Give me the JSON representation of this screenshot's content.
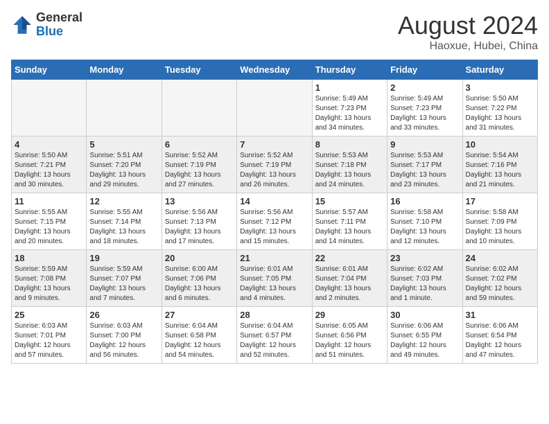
{
  "logo": {
    "text_general": "General",
    "text_blue": "Blue"
  },
  "title": "August 2024",
  "subtitle": "Haoxue, Hubei, China",
  "days_of_week": [
    "Sunday",
    "Monday",
    "Tuesday",
    "Wednesday",
    "Thursday",
    "Friday",
    "Saturday"
  ],
  "weeks": [
    [
      {
        "day": "",
        "info": ""
      },
      {
        "day": "",
        "info": ""
      },
      {
        "day": "",
        "info": ""
      },
      {
        "day": "",
        "info": ""
      },
      {
        "day": "1",
        "info": "Sunrise: 5:49 AM\nSunset: 7:23 PM\nDaylight: 13 hours\nand 34 minutes."
      },
      {
        "day": "2",
        "info": "Sunrise: 5:49 AM\nSunset: 7:23 PM\nDaylight: 13 hours\nand 33 minutes."
      },
      {
        "day": "3",
        "info": "Sunrise: 5:50 AM\nSunset: 7:22 PM\nDaylight: 13 hours\nand 31 minutes."
      }
    ],
    [
      {
        "day": "4",
        "info": "Sunrise: 5:50 AM\nSunset: 7:21 PM\nDaylight: 13 hours\nand 30 minutes."
      },
      {
        "day": "5",
        "info": "Sunrise: 5:51 AM\nSunset: 7:20 PM\nDaylight: 13 hours\nand 29 minutes."
      },
      {
        "day": "6",
        "info": "Sunrise: 5:52 AM\nSunset: 7:19 PM\nDaylight: 13 hours\nand 27 minutes."
      },
      {
        "day": "7",
        "info": "Sunrise: 5:52 AM\nSunset: 7:19 PM\nDaylight: 13 hours\nand 26 minutes."
      },
      {
        "day": "8",
        "info": "Sunrise: 5:53 AM\nSunset: 7:18 PM\nDaylight: 13 hours\nand 24 minutes."
      },
      {
        "day": "9",
        "info": "Sunrise: 5:53 AM\nSunset: 7:17 PM\nDaylight: 13 hours\nand 23 minutes."
      },
      {
        "day": "10",
        "info": "Sunrise: 5:54 AM\nSunset: 7:16 PM\nDaylight: 13 hours\nand 21 minutes."
      }
    ],
    [
      {
        "day": "11",
        "info": "Sunrise: 5:55 AM\nSunset: 7:15 PM\nDaylight: 13 hours\nand 20 minutes."
      },
      {
        "day": "12",
        "info": "Sunrise: 5:55 AM\nSunset: 7:14 PM\nDaylight: 13 hours\nand 18 minutes."
      },
      {
        "day": "13",
        "info": "Sunrise: 5:56 AM\nSunset: 7:13 PM\nDaylight: 13 hours\nand 17 minutes."
      },
      {
        "day": "14",
        "info": "Sunrise: 5:56 AM\nSunset: 7:12 PM\nDaylight: 13 hours\nand 15 minutes."
      },
      {
        "day": "15",
        "info": "Sunrise: 5:57 AM\nSunset: 7:11 PM\nDaylight: 13 hours\nand 14 minutes."
      },
      {
        "day": "16",
        "info": "Sunrise: 5:58 AM\nSunset: 7:10 PM\nDaylight: 13 hours\nand 12 minutes."
      },
      {
        "day": "17",
        "info": "Sunrise: 5:58 AM\nSunset: 7:09 PM\nDaylight: 13 hours\nand 10 minutes."
      }
    ],
    [
      {
        "day": "18",
        "info": "Sunrise: 5:59 AM\nSunset: 7:08 PM\nDaylight: 13 hours\nand 9 minutes."
      },
      {
        "day": "19",
        "info": "Sunrise: 5:59 AM\nSunset: 7:07 PM\nDaylight: 13 hours\nand 7 minutes."
      },
      {
        "day": "20",
        "info": "Sunrise: 6:00 AM\nSunset: 7:06 PM\nDaylight: 13 hours\nand 6 minutes."
      },
      {
        "day": "21",
        "info": "Sunrise: 6:01 AM\nSunset: 7:05 PM\nDaylight: 13 hours\nand 4 minutes."
      },
      {
        "day": "22",
        "info": "Sunrise: 6:01 AM\nSunset: 7:04 PM\nDaylight: 13 hours\nand 2 minutes."
      },
      {
        "day": "23",
        "info": "Sunrise: 6:02 AM\nSunset: 7:03 PM\nDaylight: 13 hours\nand 1 minute."
      },
      {
        "day": "24",
        "info": "Sunrise: 6:02 AM\nSunset: 7:02 PM\nDaylight: 12 hours\nand 59 minutes."
      }
    ],
    [
      {
        "day": "25",
        "info": "Sunrise: 6:03 AM\nSunset: 7:01 PM\nDaylight: 12 hours\nand 57 minutes."
      },
      {
        "day": "26",
        "info": "Sunrise: 6:03 AM\nSunset: 7:00 PM\nDaylight: 12 hours\nand 56 minutes."
      },
      {
        "day": "27",
        "info": "Sunrise: 6:04 AM\nSunset: 6:58 PM\nDaylight: 12 hours\nand 54 minutes."
      },
      {
        "day": "28",
        "info": "Sunrise: 6:04 AM\nSunset: 6:57 PM\nDaylight: 12 hours\nand 52 minutes."
      },
      {
        "day": "29",
        "info": "Sunrise: 6:05 AM\nSunset: 6:56 PM\nDaylight: 12 hours\nand 51 minutes."
      },
      {
        "day": "30",
        "info": "Sunrise: 6:06 AM\nSunset: 6:55 PM\nDaylight: 12 hours\nand 49 minutes."
      },
      {
        "day": "31",
        "info": "Sunrise: 6:06 AM\nSunset: 6:54 PM\nDaylight: 12 hours\nand 47 minutes."
      }
    ]
  ]
}
